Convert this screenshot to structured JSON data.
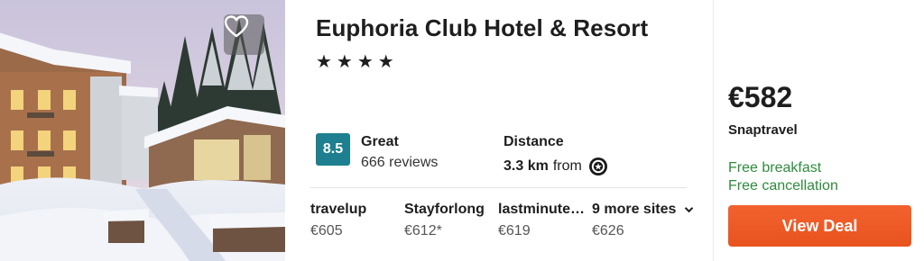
{
  "hotel": {
    "name": "Euphoria Club Hotel & Resort",
    "stars": "★★★★"
  },
  "rating": {
    "score": "8.5",
    "label": "Great",
    "reviews": "666 reviews",
    "badge_color": "#1d7f8f"
  },
  "distance": {
    "label": "Distance",
    "value": "3.3 km",
    "suffix": "from",
    "icon": "landmark-icon"
  },
  "other_sites": [
    {
      "name": "travelup",
      "price": "€605"
    },
    {
      "name": "Stayforlong",
      "price": "€612*"
    },
    {
      "name": "lastminute.com",
      "price": "€619"
    },
    {
      "name": "9 more sites",
      "price": "€626"
    }
  ],
  "deal": {
    "price": "€582",
    "provider": "Snaptravel",
    "perks": [
      "Free breakfast",
      "Free cancellation"
    ],
    "button_label": "View Deal",
    "button_color": "#f0602a",
    "perk_color": "#2e8b3d"
  },
  "icons": {
    "favorite": "heart-outline-icon",
    "expand": "chevron-down-icon"
  }
}
